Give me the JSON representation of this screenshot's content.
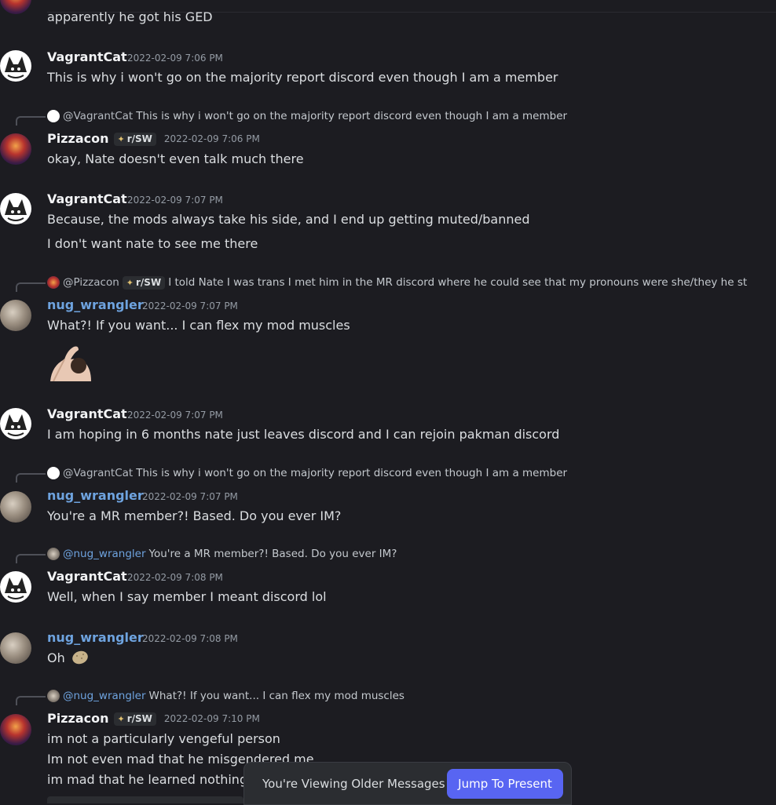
{
  "messages": {
    "m0": {
      "text": "apparently he got his GED"
    },
    "m1": {
      "user": "VagrantCat",
      "time": "2022-02-09 7:06 PM",
      "text": "This is why i won't go on the majority report discord even though I am a member"
    },
    "m2": {
      "reply_user": "@VagrantCat",
      "reply_text": "This is why i won't go on the majority report discord even though I am a member",
      "user": "Pizzacon",
      "tag": "r/SW",
      "time": "2022-02-09 7:06 PM",
      "text": "okay, Nate doesn't even talk much there"
    },
    "m3": {
      "user": "VagrantCat",
      "time": "2022-02-09 7:07 PM",
      "text": "Because, the mods always take his side, and I end up getting muted/banned",
      "text2": "I don't want nate to see me there"
    },
    "m4": {
      "reply_user": "@Pizzacon",
      "reply_tag": "r/SW",
      "reply_text": "I told Nate I was trans I met him in the MR discord where he could see that my pronouns were she/they he st",
      "user": "nug_wrangler",
      "time": "2022-02-09 7:07 PM",
      "text": "What?! If you want... I can flex my mod muscles"
    },
    "m5": {
      "user": "VagrantCat",
      "time": "2022-02-09 7:07 PM",
      "text": "I am hoping in 6 months nate just leaves discord and I can rejoin pakman discord"
    },
    "m6": {
      "reply_user": "@VagrantCat",
      "reply_text": "This is why i won't go on the majority report discord even though I am a member",
      "user": "nug_wrangler",
      "time": "2022-02-09 7:07 PM",
      "text": "You're a MR member?! Based. Do you ever IM?"
    },
    "m7": {
      "reply_user": "@nug_wrangler",
      "reply_text": "You're a MR member?! Based. Do you ever IM?",
      "user": "VagrantCat",
      "time": "2022-02-09 7:08 PM",
      "text": "Well, when I say member I meant discord lol"
    },
    "m8": {
      "user": "nug_wrangler",
      "time": "2022-02-09 7:08 PM",
      "text": "Oh"
    },
    "m9": {
      "reply_user": "@nug_wrangler",
      "reply_text": "What?! If you want... I can flex my mod muscles",
      "user": "Pizzacon",
      "tag": "r/SW",
      "time": "2022-02-09 7:10 PM",
      "text": "im not a particularly vengeful person",
      "text2": "Im not even mad that he misgendered me",
      "text3": "im mad that he learned nothing"
    }
  },
  "banner": {
    "label": "You're Viewing Older Messages",
    "button": "Jump To Present"
  },
  "icons": {
    "tag_icon": "sparkle-icon",
    "sticker": "flexing-man-sticker",
    "emoji": "potato-emoji"
  },
  "colors": {
    "background": "#1c1c21",
    "accent": "#5865f2",
    "username_blue": "#6ea3df",
    "text": "#dbdee1",
    "timestamp": "#949ba4"
  }
}
